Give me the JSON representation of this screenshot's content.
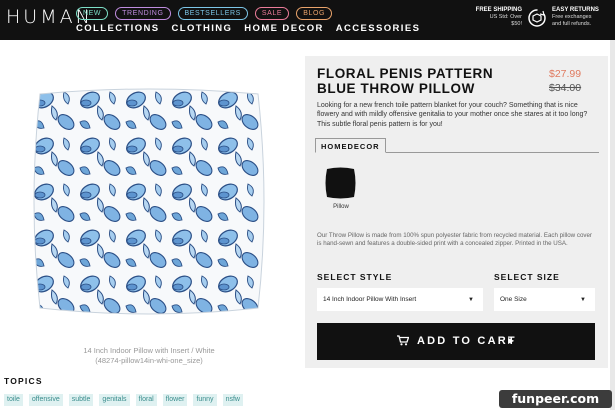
{
  "header": {
    "logo": "HUMAN",
    "pills": [
      {
        "label": "NEW"
      },
      {
        "label": "TRENDING"
      },
      {
        "label": "BESTSELLERS"
      },
      {
        "label": "SALE"
      },
      {
        "label": "BLOG"
      }
    ],
    "nav": [
      "COLLECTIONS",
      "CLOTHING",
      "HOME DECOR",
      "ACCESSORIES"
    ],
    "shipping": {
      "title": "FREE SHIPPING",
      "line1": "US Std: Over",
      "line2": "$50!"
    },
    "returns": {
      "title": "EASY RETURNS",
      "line1": "Free exchanges",
      "line2": "and full refunds."
    }
  },
  "product": {
    "title": "FLORAL PENIS PATTERN BLUE THROW PILLOW",
    "price_sale": "$27.99",
    "price_original": "$34.00",
    "description": "Looking for a new french toile pattern blanket for your couch? Something that is nice flowery and with mildly offensive genitalia to your mother once she stares at it too long? This subtle floral penis pattern is for you!",
    "category_tab": "HOMEDECOR",
    "swatch_label": "Pillow",
    "details": "Our Throw Pillow is made from 100% spun polyester fabric from recycled material. Each pillow cover is hand-sewn and features a double-sided print with a concealed zipper. Printed in the USA.",
    "image_caption_line1": "14 Inch Indoor Pillow with Insert / White",
    "image_caption_line2": "(48274-pillow14in-whi-one_size)",
    "colors": {
      "pattern_blue": "#6ea6d8",
      "pattern_outline": "#2b4f86",
      "cart_bg": "#111111",
      "sale_price": "#e07a5f"
    }
  },
  "select_style": {
    "label": "SELECT STYLE",
    "value": "14 Inch Indoor Pillow With Insert"
  },
  "select_size": {
    "label": "SELECT SIZE",
    "value": "One Size"
  },
  "cart": {
    "label": "ADD TO CART",
    "icon": "cart-icon"
  },
  "topics": {
    "title": "TOPICS",
    "tags": [
      "toile",
      "offensive",
      "subtle",
      "genitals",
      "floral",
      "flower",
      "funny",
      "nsfw"
    ]
  },
  "watermark": "funpeer.com"
}
